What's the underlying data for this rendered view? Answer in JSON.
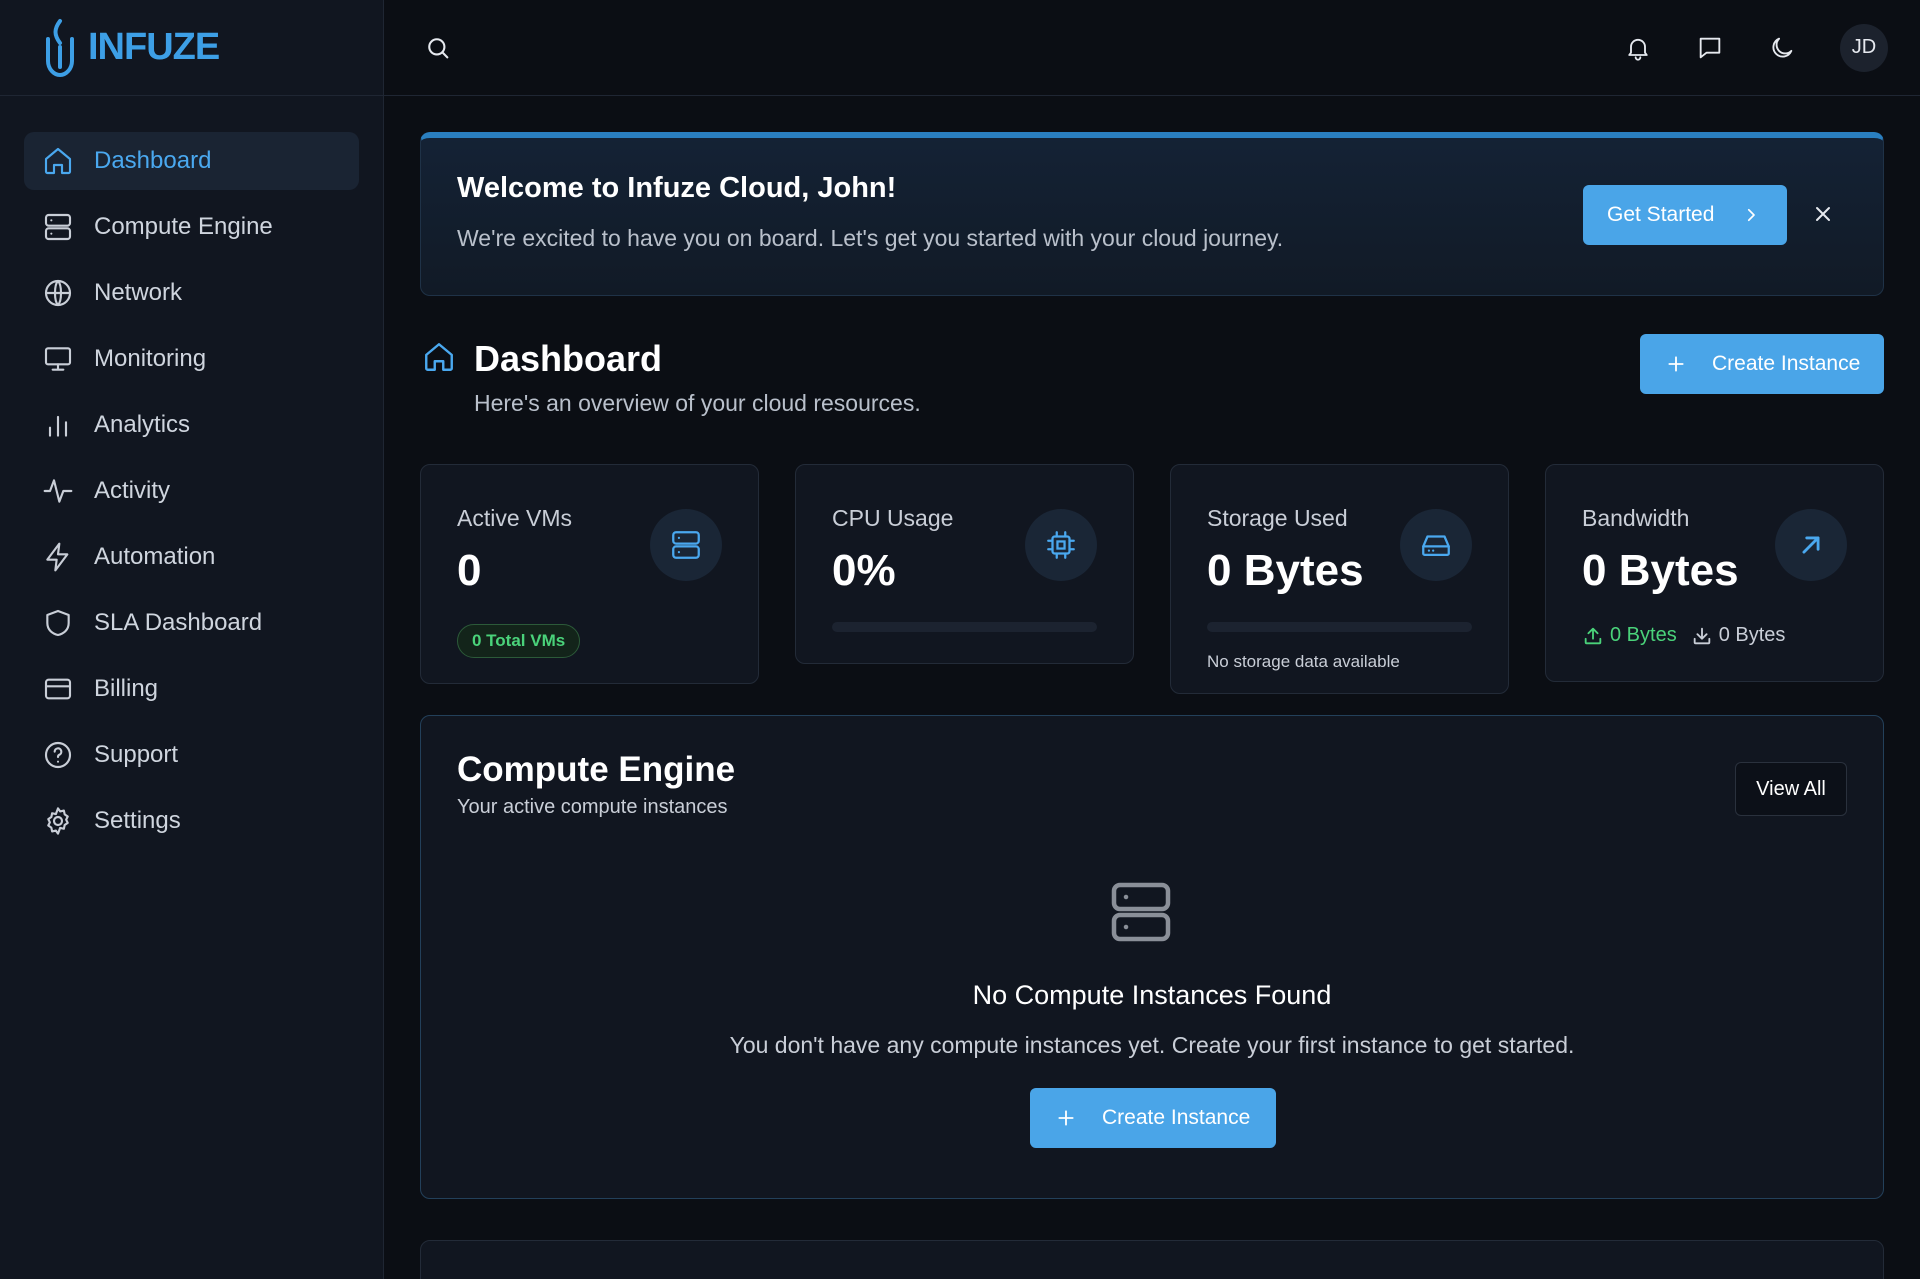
{
  "brand": {
    "name": "INFUZE",
    "accent": "#3d9fe6"
  },
  "sidebar": {
    "items": [
      {
        "label": "Dashboard",
        "icon": "home-icon",
        "active": true
      },
      {
        "label": "Compute Engine",
        "icon": "server-icon"
      },
      {
        "label": "Network",
        "icon": "globe-icon"
      },
      {
        "label": "Monitoring",
        "icon": "monitor-icon"
      },
      {
        "label": "Analytics",
        "icon": "bar-chart-icon"
      },
      {
        "label": "Activity",
        "icon": "activity-icon"
      },
      {
        "label": "Automation",
        "icon": "lightning-icon"
      },
      {
        "label": "SLA Dashboard",
        "icon": "shield-icon"
      },
      {
        "label": "Billing",
        "icon": "credit-card-icon"
      },
      {
        "label": "Support",
        "icon": "help-circle-icon"
      },
      {
        "label": "Settings",
        "icon": "gear-icon"
      }
    ]
  },
  "topbar": {
    "avatar_initials": "JD",
    "icons": [
      "search-icon",
      "bell-icon",
      "message-icon",
      "moon-icon"
    ]
  },
  "welcome": {
    "title": "Welcome to Infuze Cloud, John!",
    "message": "We're excited to have you on board. Let's get you started with your cloud journey.",
    "cta_label": "Get Started"
  },
  "dashboard": {
    "title": "Dashboard",
    "subtitle": "Here's an overview of your cloud resources.",
    "create_label": "Create Instance"
  },
  "stats": {
    "active_vms": {
      "label": "Active VMs",
      "value": "0",
      "badge": "0 Total VMs"
    },
    "cpu": {
      "label": "CPU Usage",
      "value": "0%",
      "progress": 0
    },
    "storage": {
      "label": "Storage Used",
      "value": "0 Bytes",
      "progress": 0,
      "note": "No storage data available"
    },
    "bandwidth": {
      "label": "Bandwidth",
      "value": "0 Bytes",
      "upload": "0 Bytes",
      "download": "0 Bytes"
    }
  },
  "compute": {
    "title": "Compute Engine",
    "subtitle": "Your active compute instances",
    "view_all_label": "View All",
    "empty_title": "No Compute Instances Found",
    "empty_message": "You don't have any compute instances yet. Create your first instance to get started.",
    "create_label": "Create Instance"
  },
  "colors": {
    "primary": "#4aa5e8",
    "success": "#4ad27a",
    "background": "#0b0e14",
    "panel": "#111620"
  }
}
